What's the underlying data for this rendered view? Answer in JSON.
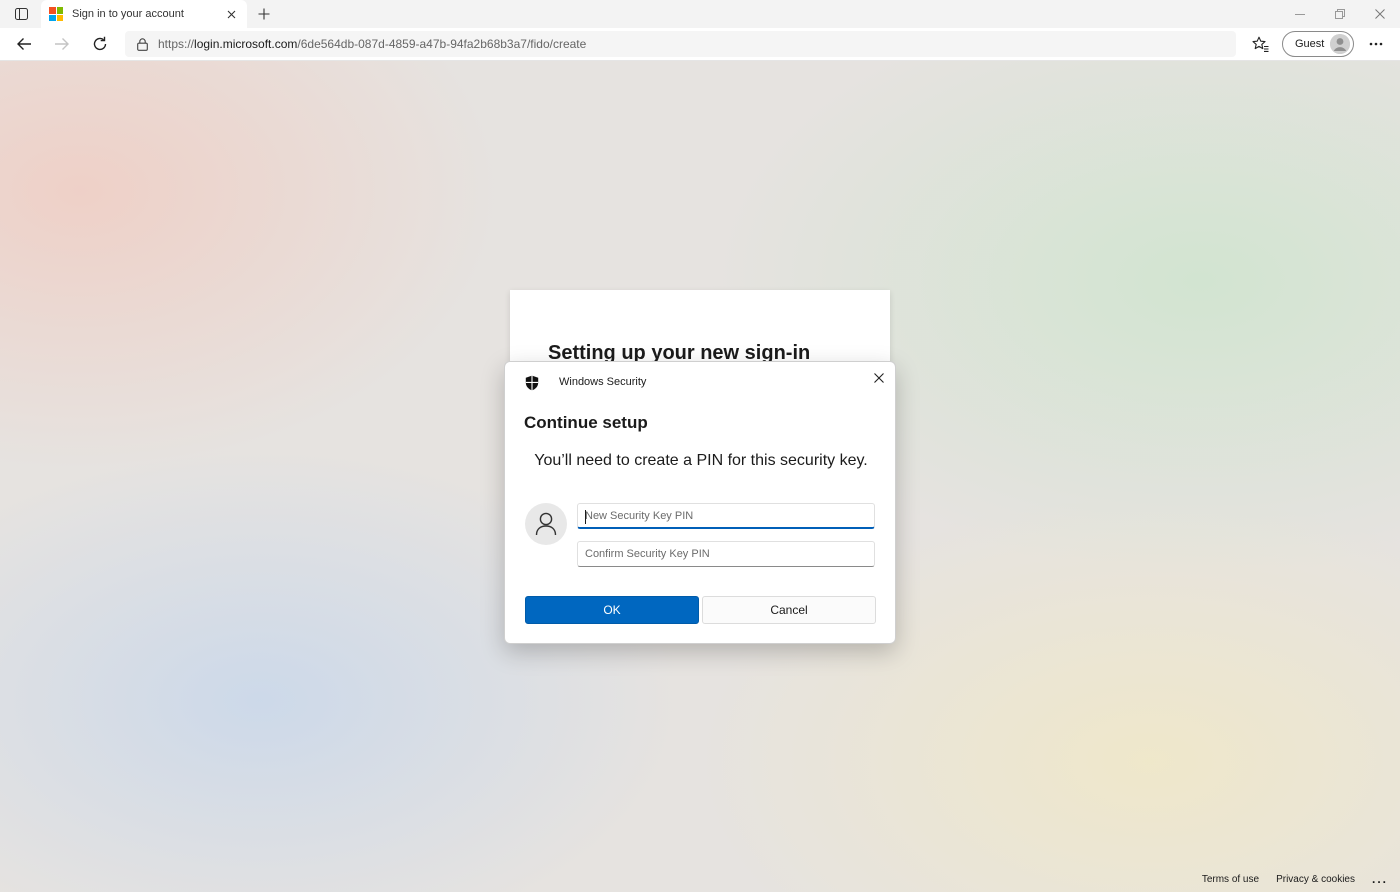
{
  "browser": {
    "tab": {
      "title": "Sign in to your account",
      "favicon": "microsoft-logo",
      "favicon_colors": [
        "#f25022",
        "#7fba00",
        "#00a4ef",
        "#ffb900"
      ]
    },
    "address": {
      "scheme": "https://",
      "host": "login.microsoft.com",
      "path": "/6de564db-087d-4859-a47b-94fa2b68b3a7/fido/create"
    },
    "profile": {
      "label": "Guest"
    },
    "icons": [
      "tab-actions-icon",
      "close-icon",
      "plus-icon",
      "minimize-icon",
      "restore-icon",
      "back-icon",
      "forward-icon",
      "refresh-icon",
      "lock-icon",
      "favorites-icon",
      "more-icon"
    ]
  },
  "page": {
    "card_title": "Setting up your new sign-in",
    "footer": {
      "terms": "Terms of use",
      "privacy": "Privacy & cookies",
      "more": "..."
    }
  },
  "dialog": {
    "app_name": "Windows Security",
    "title": "Continue setup",
    "message": "You’ll need to create a PIN for this security key.",
    "new_pin_placeholder": "New Security Key PIN",
    "confirm_pin_placeholder": "Confirm Security Key PIN",
    "ok_label": "OK",
    "cancel_label": "Cancel",
    "accent_color": "#0067c0"
  }
}
